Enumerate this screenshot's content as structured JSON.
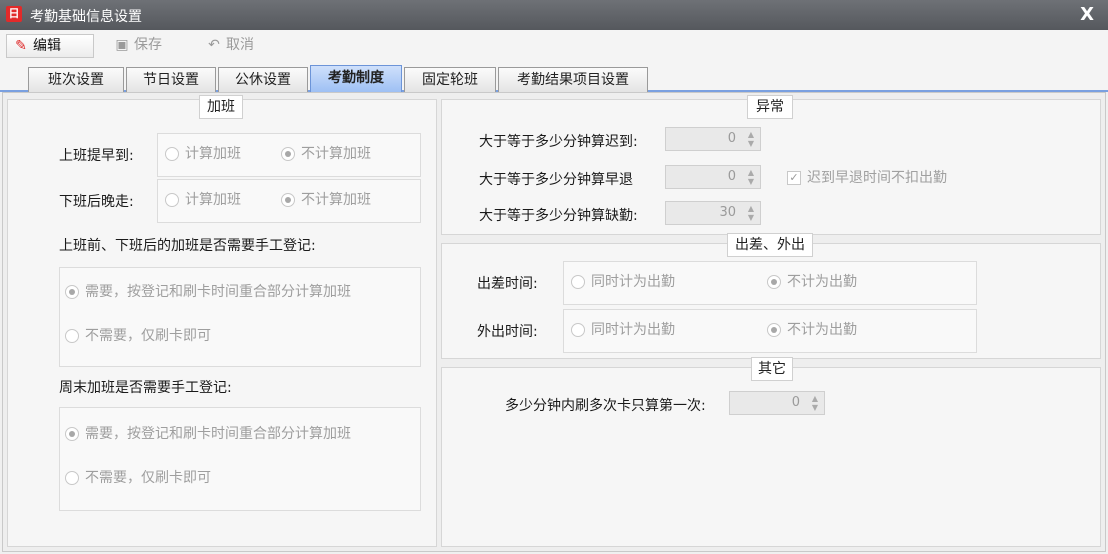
{
  "window": {
    "title": "考勤基础信息设置",
    "app_icon_glyph": "日",
    "close": "X"
  },
  "toolbar": {
    "edit": "编辑",
    "save": "保存",
    "cancel": "取消"
  },
  "tabs": [
    "班次设置",
    "节日设置",
    "公休设置",
    "考勤制度",
    "固定轮班",
    "考勤结果项目设置"
  ],
  "active_tab": "考勤制度",
  "overtime": {
    "title": "加班",
    "early_label": "上班提早到:",
    "late_label": "下班后晚走:",
    "opt_count": "计算加班",
    "opt_nocount": "不计算加班",
    "manual_q1": "上班前、下班后的加班是否需要手工登记:",
    "opt_need": "需要，按登记和刷卡时间重合部分计算加班",
    "opt_noneed": "不需要，仅刷卡即可",
    "manual_q2": "周末加班是否需要手工登记:"
  },
  "abnormal": {
    "title": "异常",
    "late_label": "大于等于多少分钟算迟到:",
    "late_value": "0",
    "early_label": "大于等于多少分钟算早退",
    "early_value": "0",
    "absent_label": "大于等于多少分钟算缺勤:",
    "absent_value": "30",
    "no_deduct": "迟到早退时间不扣出勤"
  },
  "trip": {
    "title": "出差、外出",
    "trip_label": "出差时间:",
    "out_label": "外出时间:",
    "opt_count": "同时计为出勤",
    "opt_nocount": "不计为出勤"
  },
  "other": {
    "title": "其它",
    "swipe_label": "多少分钟内刷多次卡只算第一次:",
    "swipe_value": "0"
  }
}
